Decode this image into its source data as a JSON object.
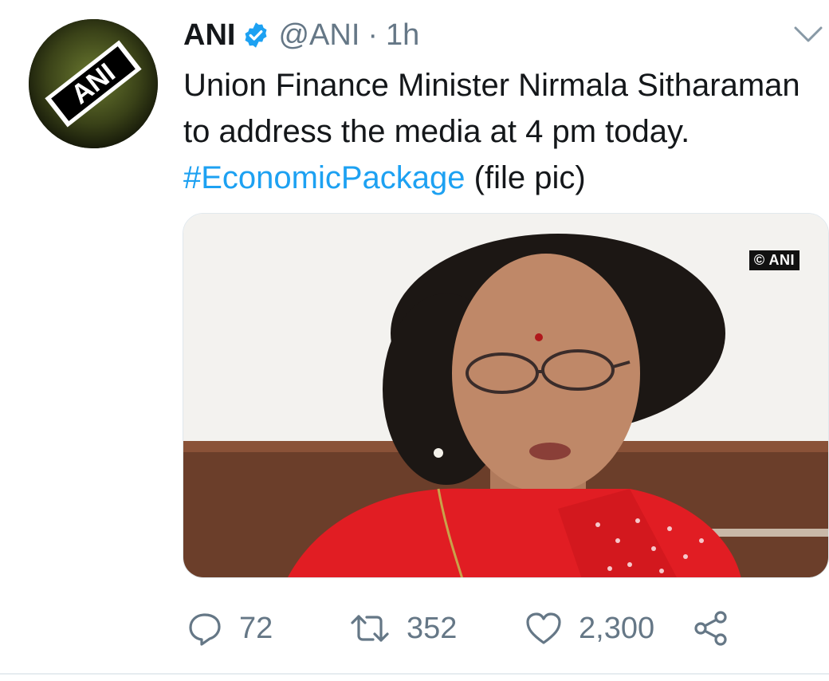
{
  "tweet": {
    "author_name": "ANI",
    "author_handle": "@ANI",
    "separator": "·",
    "time": "1h",
    "text_before": "Union Finance Minister Nirmala Sitharaman to address the media at 4 pm today. ",
    "hashtag": "#EconomicPackage",
    "text_after": " (file pic)",
    "media_watermark": "© ANI",
    "avatar_logo_text": "ANI"
  },
  "actions": {
    "reply_count": "72",
    "retweet_count": "352",
    "like_count": "2,300"
  },
  "icons": {
    "verified": "verified-badge-icon",
    "menu": "chevron-down-icon",
    "reply": "reply-icon",
    "retweet": "retweet-icon",
    "like": "heart-icon",
    "share": "share-icon"
  },
  "colors": {
    "text": "#14171a",
    "secondary": "#657786",
    "link": "#1da1f2",
    "verified": "#1da1f2"
  }
}
